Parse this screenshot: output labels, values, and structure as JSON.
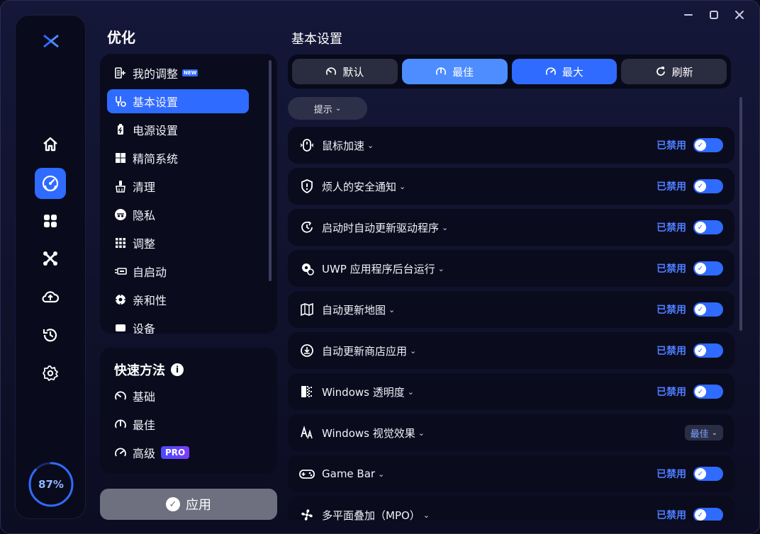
{
  "sidebar": {
    "gauge_value": "87%",
    "gauge_fraction": 0.87,
    "nav_icons": [
      "home-icon",
      "optimize-gauge-icon",
      "apps-grid-icon",
      "tools-x-icon",
      "cloud-upload-icon",
      "restore-history-icon",
      "settings-gear-icon"
    ],
    "active_index": 1
  },
  "menu": {
    "title": "优化",
    "items": [
      {
        "label": "我的调整",
        "icon": "my-tweaks-icon",
        "badge": "NEW"
      },
      {
        "label": "基本设置",
        "icon": "basic-settings-icon"
      },
      {
        "label": "电源设置",
        "icon": "battery-icon"
      },
      {
        "label": "精简系统",
        "icon": "windows-icon"
      },
      {
        "label": "清理",
        "icon": "cleanup-brush-icon"
      },
      {
        "label": "隐私",
        "icon": "privacy-spy-icon"
      },
      {
        "label": "调整",
        "icon": "grid-dots-icon"
      },
      {
        "label": "自启动",
        "icon": "startup-icon"
      },
      {
        "label": "亲和性",
        "icon": "cpu-affinity-icon"
      },
      {
        "label": "设备",
        "icon": "device-icon"
      }
    ],
    "active_index": 1
  },
  "quick": {
    "title": "快速方法",
    "items": [
      {
        "label": "基础",
        "icon": "gauge-low-icon"
      },
      {
        "label": "最佳",
        "icon": "gauge-mid-icon"
      },
      {
        "label": "高级",
        "icon": "gauge-high-icon",
        "badge": "PRO"
      }
    ]
  },
  "apply_label": "应用",
  "main": {
    "title": "基本设置",
    "presets": [
      {
        "label": "默认",
        "icon": "gauge-low-icon"
      },
      {
        "label": "最佳",
        "icon": "gauge-mid-icon"
      },
      {
        "label": "最大",
        "icon": "gauge-high-icon"
      },
      {
        "label": "刷新",
        "icon": "refresh-icon"
      }
    ],
    "hint_label": "提示",
    "settings": [
      {
        "label": "鼠标加速",
        "icon": "mouse-icon",
        "status": "已禁用",
        "control": "toggle"
      },
      {
        "label": "烦人的安全通知",
        "icon": "shield-alert-icon",
        "status": "已禁用",
        "control": "toggle"
      },
      {
        "label": "启动时自动更新驱动程序",
        "icon": "update-clock-icon",
        "status": "已禁用",
        "control": "toggle"
      },
      {
        "label": "UWP 应用程序后台运行",
        "icon": "gear-refresh-icon",
        "status": "已禁用",
        "control": "toggle"
      },
      {
        "label": "自动更新地图",
        "icon": "map-icon",
        "status": "已禁用",
        "control": "toggle"
      },
      {
        "label": "自动更新商店应用",
        "icon": "download-circle-icon",
        "status": "已禁用",
        "control": "toggle"
      },
      {
        "label": "Windows 透明度",
        "icon": "transparency-icon",
        "status": "已禁用",
        "control": "toggle"
      },
      {
        "label": "Windows 视觉效果",
        "icon": "visual-effects-icon",
        "status": "最佳",
        "control": "select"
      },
      {
        "label": "Game Bar",
        "icon": "gamepad-icon",
        "status": "已禁用",
        "control": "toggle"
      },
      {
        "label": "多平面叠加（MPO）",
        "icon": "fan-icon",
        "status": "已禁用",
        "control": "toggle"
      }
    ]
  },
  "colors": {
    "accent": "#2f6bff",
    "accent_light": "#4d8dff",
    "status_text": "#4d7dff"
  }
}
